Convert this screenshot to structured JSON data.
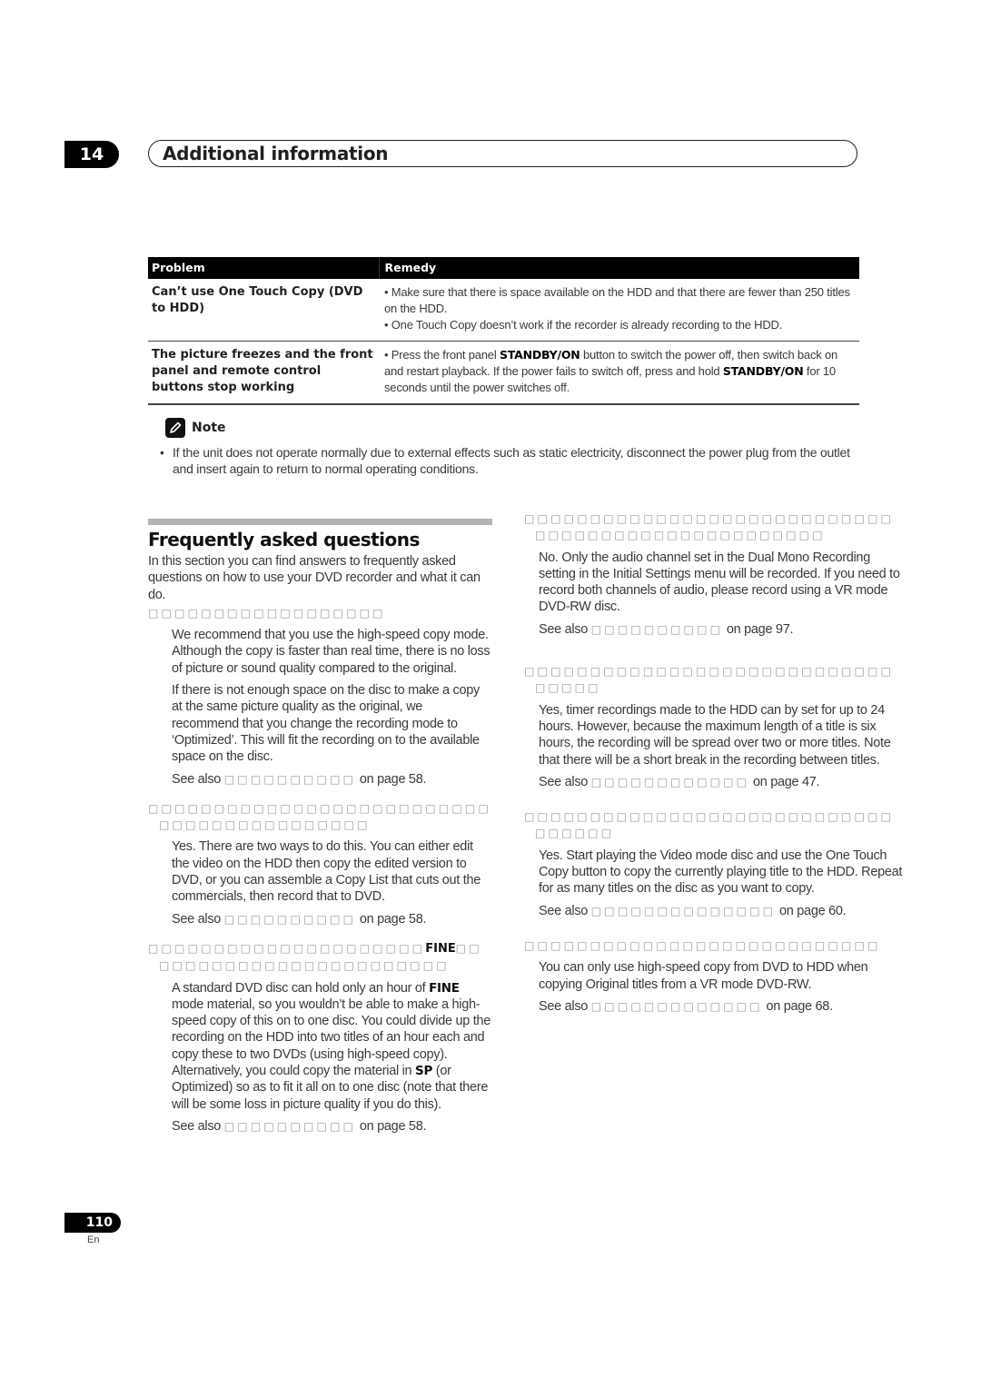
{
  "header": {
    "chapter_number": "14",
    "chapter_title": "Additional information"
  },
  "table": {
    "columns": [
      "Problem",
      "Remedy"
    ],
    "rows": [
      {
        "problem": "Can’t use One Touch Copy (DVD to HDD)",
        "remedy": [
          "• Make sure that there is space available on the HDD and that there are fewer than 250 titles on the HDD.",
          "• One Touch Copy doesn’t work if the recorder is already recording to the HDD."
        ]
      },
      {
        "problem": "The picture freezes and the front panel and remote control buttons stop working",
        "remedy_parts": {
          "p1": "• Press the front panel ",
          "b1": "STANDBY/ON",
          "p2": " button to switch the power off, then switch back on and restart playback. If the power fails to switch off, press and hold ",
          "b2": "STANDBY/ON",
          "p3": " for 10 seconds until the power switches off."
        }
      }
    ]
  },
  "note": {
    "icon": "pencil-icon",
    "label": "Note",
    "bullet": "•",
    "text": "If the unit does not operate normally due to external effects such as static electricity, disconnect the power plug from the outlet and insert again to return to normal operating conditions."
  },
  "faq": {
    "title": "Frequently asked questions",
    "intro": "In this section you can find answers to frequently asked questions on how to use your DVD recorder and what it can do.",
    "see_also": "See also",
    "left": [
      {
        "question": "□□□□□□□□□□□□□□□□□□",
        "answers": [
          "We recommend that you use the high-speed copy mode. Although the copy is faster than real time, there is no loss of picture or sound quality compared to the original.",
          "If there is not enough space on the disc to make a copy at the same picture quality as the original, we recommend that you change the recording mode to ‘Optimized’. This will fit the recording on to the available space on the disc."
        ],
        "ref": "□□□□□□□□□□",
        "page_suffix": "on page 58."
      },
      {
        "question": "□□□□□□□□□□□□□□□□□□□□□□□□□□□□□□□□□□□□□□□□□□",
        "answers": [
          "Yes. There are two ways to do this. You can either edit the video on the HDD then copy the edited version to DVD, or you can assemble a Copy List that cuts out the commercials, then record that to DVD."
        ],
        "ref": "□□□□□□□□□□",
        "page_suffix": "on page 58."
      },
      {
        "question_pre": "□□□□□□□□□□□□□□□□□□□□□",
        "question_bold": "FINE",
        "question_post": "□□□□□□□□□□□□□□□□□□□□□□□□",
        "answer_parts": {
          "a1": "A standard DVD disc can hold only an hour of ",
          "b1": "FINE",
          "a2": " mode material, so you wouldn’t be able to make a high-speed copy of this on to one disc. You could divide up the recording on the HDD into two titles of an hour each and copy these to two DVDs (using high-speed copy). Alternatively, you could copy the material in ",
          "b2": "SP",
          "a3": " (or Optimized) so as to fit it all on to one disc (note that there will be some loss in picture quality if you do this)."
        },
        "ref": "□□□□□□□□□□",
        "page_suffix": "on page 58."
      }
    ],
    "right": [
      {
        "question": "□□□□□□□□□□□□□□□□□□□□□□□□□□□□□□□□□□□□□□□□□□□□□□□□□□",
        "answers": [
          "No. Only the audio channel set in the Dual Mono Recording setting in the Initial Settings menu will be recorded. If you need to record both channels of audio, please record using a VR mode DVD-RW disc."
        ],
        "ref": "□□□□□□□□□□",
        "page_suffix": "on page 97."
      },
      {
        "question": "□□□□□□□□□□□□□□□□□□□□□□□□□□□□□□□□□",
        "answers": [
          "Yes, timer recordings made to the HDD can by set for up to 24 hours. However, because the maximum length of a title is six hours, the recording will be spread over two or more titles. Note that there will be a short break in the recording between titles."
        ],
        "ref": "□□□□□□□□□□□□",
        "page_suffix": "on page 47."
      },
      {
        "question": "□□□□□□□□□□□□□□□□□□□□□□□□□□□□□□□□□□",
        "answers": [
          "Yes. Start playing the Video mode disc and use the One Touch Copy button to copy the currently playing title to the HDD. Repeat for as many titles on the disc as you want to copy."
        ],
        "ref": "□□□□□□□□□□□□□□",
        "page_suffix": "on page 60."
      },
      {
        "question": "□□□□□□□□□□□□□□□□□□□□□□□□□□□",
        "answers": [
          "You  can only use high-speed copy from DVD to HDD when copying Original titles from a VR mode DVD-RW."
        ],
        "ref": "□□□□□□□□□□□□□",
        "page_suffix": "on page 68."
      }
    ]
  },
  "footer": {
    "page_number": "110",
    "language": "En"
  }
}
